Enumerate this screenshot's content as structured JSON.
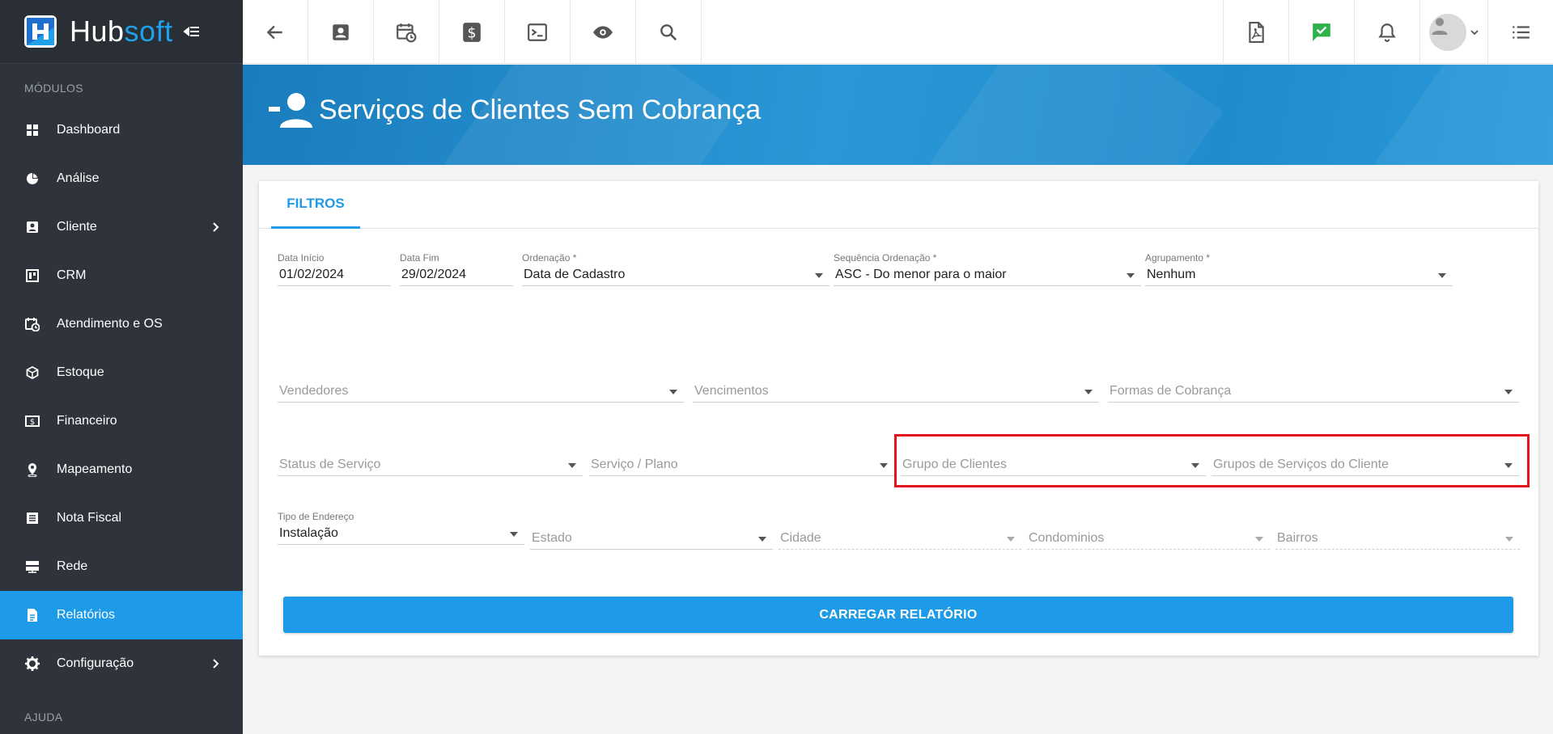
{
  "brand": {
    "name_part1": "Hub",
    "name_part2": "soft"
  },
  "sidebar": {
    "section_modules": "MÓDULOS",
    "section_help": "AJUDA",
    "items": [
      {
        "label": "Dashboard",
        "icon": "dashboard-icon"
      },
      {
        "label": "Análise",
        "icon": "pie-chart-icon"
      },
      {
        "label": "Cliente",
        "icon": "contact-card-icon",
        "submenu": true
      },
      {
        "label": "CRM",
        "icon": "kanban-icon"
      },
      {
        "label": "Atendimento e OS",
        "icon": "calendar-clock-icon"
      },
      {
        "label": "Estoque",
        "icon": "box-icon"
      },
      {
        "label": "Financeiro",
        "icon": "money-icon"
      },
      {
        "label": "Mapeamento",
        "icon": "map-pin-icon"
      },
      {
        "label": "Nota Fiscal",
        "icon": "document-list-icon"
      },
      {
        "label": "Rede",
        "icon": "server-icon"
      },
      {
        "label": "Relatórios",
        "icon": "report-icon",
        "active": true
      },
      {
        "label": "Configuração",
        "icon": "gear-icon",
        "submenu": true
      }
    ]
  },
  "topbar": {
    "left_icons": [
      "back-arrow-icon",
      "contact-card-icon",
      "calendar-clock-icon",
      "dollar-icon",
      "terminal-icon",
      "eye-icon",
      "search-icon"
    ],
    "right_icons": [
      "pdf-icon",
      "chat-check-icon",
      "bell-icon",
      "avatar",
      "list-icon"
    ]
  },
  "colors": {
    "accent": "#1e9be8",
    "sidebar": "#2f333b",
    "highlight": "#e3141b",
    "check_green": "#2db34a"
  },
  "page": {
    "title": "Serviços de Clientes Sem Cobrança"
  },
  "tabs": [
    {
      "label": "FILTROS"
    }
  ],
  "filters": {
    "data_inicio": {
      "label": "Data Início",
      "value": "01/02/2024"
    },
    "data_fim": {
      "label": "Data Fim",
      "value": "29/02/2024"
    },
    "ordenacao": {
      "label": "Ordenação *",
      "value": "Data de Cadastro"
    },
    "sequencia": {
      "label": "Sequência Ordenação *",
      "value": "ASC - Do menor para o maior"
    },
    "agrupamento": {
      "label": "Agrupamento *",
      "value": "Nenhum"
    },
    "vendedores": {
      "placeholder": "Vendedores"
    },
    "vencimentos": {
      "placeholder": "Vencimentos"
    },
    "formas_cobranca": {
      "placeholder": "Formas de Cobrança"
    },
    "status_servico": {
      "placeholder": "Status de Serviço"
    },
    "servico_plano": {
      "placeholder": "Serviço / Plano"
    },
    "grupo_clientes": {
      "placeholder": "Grupo de Clientes"
    },
    "grupos_servicos": {
      "placeholder": "Grupos de Serviços do Cliente"
    },
    "tipo_endereco": {
      "label": "Tipo de Endereço",
      "value": "Instalação"
    },
    "estado": {
      "placeholder": "Estado"
    },
    "cidade": {
      "placeholder": "Cidade"
    },
    "condominios": {
      "placeholder": "Condominios"
    },
    "bairros": {
      "placeholder": "Bairros"
    }
  },
  "actions": {
    "load_report": "CARREGAR RELATÓRIO"
  }
}
